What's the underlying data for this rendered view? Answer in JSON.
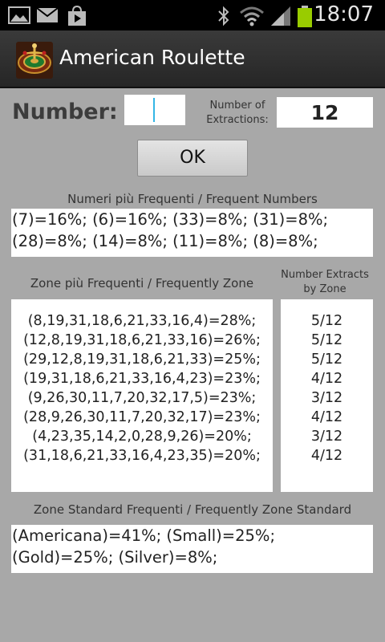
{
  "status_bar": {
    "time": "18:07",
    "left_icons": [
      "gallery-icon",
      "mail-icon",
      "store-icon"
    ],
    "right_icons": [
      "bluetooth-icon",
      "wifi-icon",
      "signal-icon",
      "battery-icon"
    ]
  },
  "app": {
    "title": "American Roulette"
  },
  "form": {
    "number_label": "Number:",
    "number_value": "",
    "extractions_label_line1": "Number of",
    "extractions_label_line2": "Extractions:",
    "extractions_value": "12",
    "ok_label": "OK"
  },
  "frequent_numbers": {
    "heading": "Numeri più Frequenti / Frequent Numbers",
    "lines": [
      "(7)=16%; (6)=16%; (33)=8%; (31)=8%;",
      "(28)=8%; (14)=8%; (11)=8%; (8)=8%;"
    ]
  },
  "frequent_zones": {
    "heading": "Zone più Frequenti / Frequently Zone",
    "extracts_heading_line1": "Number Extracts",
    "extracts_heading_line2": "by Zone",
    "zones": [
      "(8,19,31,18,6,21,33,16,4)=28%;",
      "(12,8,19,31,18,6,21,33,16)=26%;",
      "(29,12,8,19,31,18,6,21,33)=25%;",
      "(19,31,18,6,21,33,16,4,23)=23%;",
      "(9,26,30,11,7,20,32,17,5)=23%;",
      "(28,9,26,30,11,7,20,32,17)=23%;",
      "(4,23,35,14,2,0,28,9,26)=20%;",
      "(31,18,6,21,33,16,4,23,35)=20%;"
    ],
    "extracts": [
      "5/12",
      "5/12",
      "5/12",
      "4/12",
      "3/12",
      "4/12",
      "3/12",
      "4/12"
    ]
  },
  "standard_zones": {
    "heading": "Zone Standard Frequenti / Frequently Zone Standard",
    "lines": [
      "(Americana)=41%; (Small)=25%;",
      "(Gold)=25%; (Silver)=8%;"
    ]
  },
  "colors": {
    "background": "#a8a8a8",
    "title_bar": "#2c2c2c",
    "accent": "#33b5e5",
    "battery": "#99cc00"
  }
}
